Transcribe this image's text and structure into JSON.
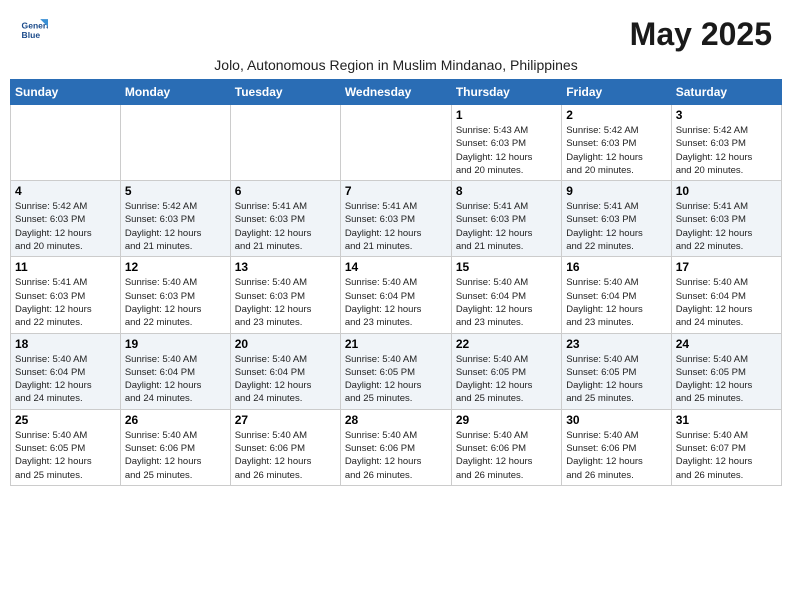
{
  "logo": {
    "line1": "General",
    "line2": "Blue"
  },
  "title": "May 2025",
  "subtitle": "Jolo, Autonomous Region in Muslim Mindanao, Philippines",
  "weekdays": [
    "Sunday",
    "Monday",
    "Tuesday",
    "Wednesday",
    "Thursday",
    "Friday",
    "Saturday"
  ],
  "weeks": [
    [
      {
        "day": "",
        "info": ""
      },
      {
        "day": "",
        "info": ""
      },
      {
        "day": "",
        "info": ""
      },
      {
        "day": "",
        "info": ""
      },
      {
        "day": "1",
        "info": "Sunrise: 5:43 AM\nSunset: 6:03 PM\nDaylight: 12 hours\nand 20 minutes."
      },
      {
        "day": "2",
        "info": "Sunrise: 5:42 AM\nSunset: 6:03 PM\nDaylight: 12 hours\nand 20 minutes."
      },
      {
        "day": "3",
        "info": "Sunrise: 5:42 AM\nSunset: 6:03 PM\nDaylight: 12 hours\nand 20 minutes."
      }
    ],
    [
      {
        "day": "4",
        "info": "Sunrise: 5:42 AM\nSunset: 6:03 PM\nDaylight: 12 hours\nand 20 minutes."
      },
      {
        "day": "5",
        "info": "Sunrise: 5:42 AM\nSunset: 6:03 PM\nDaylight: 12 hours\nand 21 minutes."
      },
      {
        "day": "6",
        "info": "Sunrise: 5:41 AM\nSunset: 6:03 PM\nDaylight: 12 hours\nand 21 minutes."
      },
      {
        "day": "7",
        "info": "Sunrise: 5:41 AM\nSunset: 6:03 PM\nDaylight: 12 hours\nand 21 minutes."
      },
      {
        "day": "8",
        "info": "Sunrise: 5:41 AM\nSunset: 6:03 PM\nDaylight: 12 hours\nand 21 minutes."
      },
      {
        "day": "9",
        "info": "Sunrise: 5:41 AM\nSunset: 6:03 PM\nDaylight: 12 hours\nand 22 minutes."
      },
      {
        "day": "10",
        "info": "Sunrise: 5:41 AM\nSunset: 6:03 PM\nDaylight: 12 hours\nand 22 minutes."
      }
    ],
    [
      {
        "day": "11",
        "info": "Sunrise: 5:41 AM\nSunset: 6:03 PM\nDaylight: 12 hours\nand 22 minutes."
      },
      {
        "day": "12",
        "info": "Sunrise: 5:40 AM\nSunset: 6:03 PM\nDaylight: 12 hours\nand 22 minutes."
      },
      {
        "day": "13",
        "info": "Sunrise: 5:40 AM\nSunset: 6:03 PM\nDaylight: 12 hours\nand 23 minutes."
      },
      {
        "day": "14",
        "info": "Sunrise: 5:40 AM\nSunset: 6:04 PM\nDaylight: 12 hours\nand 23 minutes."
      },
      {
        "day": "15",
        "info": "Sunrise: 5:40 AM\nSunset: 6:04 PM\nDaylight: 12 hours\nand 23 minutes."
      },
      {
        "day": "16",
        "info": "Sunrise: 5:40 AM\nSunset: 6:04 PM\nDaylight: 12 hours\nand 23 minutes."
      },
      {
        "day": "17",
        "info": "Sunrise: 5:40 AM\nSunset: 6:04 PM\nDaylight: 12 hours\nand 24 minutes."
      }
    ],
    [
      {
        "day": "18",
        "info": "Sunrise: 5:40 AM\nSunset: 6:04 PM\nDaylight: 12 hours\nand 24 minutes."
      },
      {
        "day": "19",
        "info": "Sunrise: 5:40 AM\nSunset: 6:04 PM\nDaylight: 12 hours\nand 24 minutes."
      },
      {
        "day": "20",
        "info": "Sunrise: 5:40 AM\nSunset: 6:04 PM\nDaylight: 12 hours\nand 24 minutes."
      },
      {
        "day": "21",
        "info": "Sunrise: 5:40 AM\nSunset: 6:05 PM\nDaylight: 12 hours\nand 25 minutes."
      },
      {
        "day": "22",
        "info": "Sunrise: 5:40 AM\nSunset: 6:05 PM\nDaylight: 12 hours\nand 25 minutes."
      },
      {
        "day": "23",
        "info": "Sunrise: 5:40 AM\nSunset: 6:05 PM\nDaylight: 12 hours\nand 25 minutes."
      },
      {
        "day": "24",
        "info": "Sunrise: 5:40 AM\nSunset: 6:05 PM\nDaylight: 12 hours\nand 25 minutes."
      }
    ],
    [
      {
        "day": "25",
        "info": "Sunrise: 5:40 AM\nSunset: 6:05 PM\nDaylight: 12 hours\nand 25 minutes."
      },
      {
        "day": "26",
        "info": "Sunrise: 5:40 AM\nSunset: 6:06 PM\nDaylight: 12 hours\nand 25 minutes."
      },
      {
        "day": "27",
        "info": "Sunrise: 5:40 AM\nSunset: 6:06 PM\nDaylight: 12 hours\nand 26 minutes."
      },
      {
        "day": "28",
        "info": "Sunrise: 5:40 AM\nSunset: 6:06 PM\nDaylight: 12 hours\nand 26 minutes."
      },
      {
        "day": "29",
        "info": "Sunrise: 5:40 AM\nSunset: 6:06 PM\nDaylight: 12 hours\nand 26 minutes."
      },
      {
        "day": "30",
        "info": "Sunrise: 5:40 AM\nSunset: 6:06 PM\nDaylight: 12 hours\nand 26 minutes."
      },
      {
        "day": "31",
        "info": "Sunrise: 5:40 AM\nSunset: 6:07 PM\nDaylight: 12 hours\nand 26 minutes."
      }
    ]
  ]
}
